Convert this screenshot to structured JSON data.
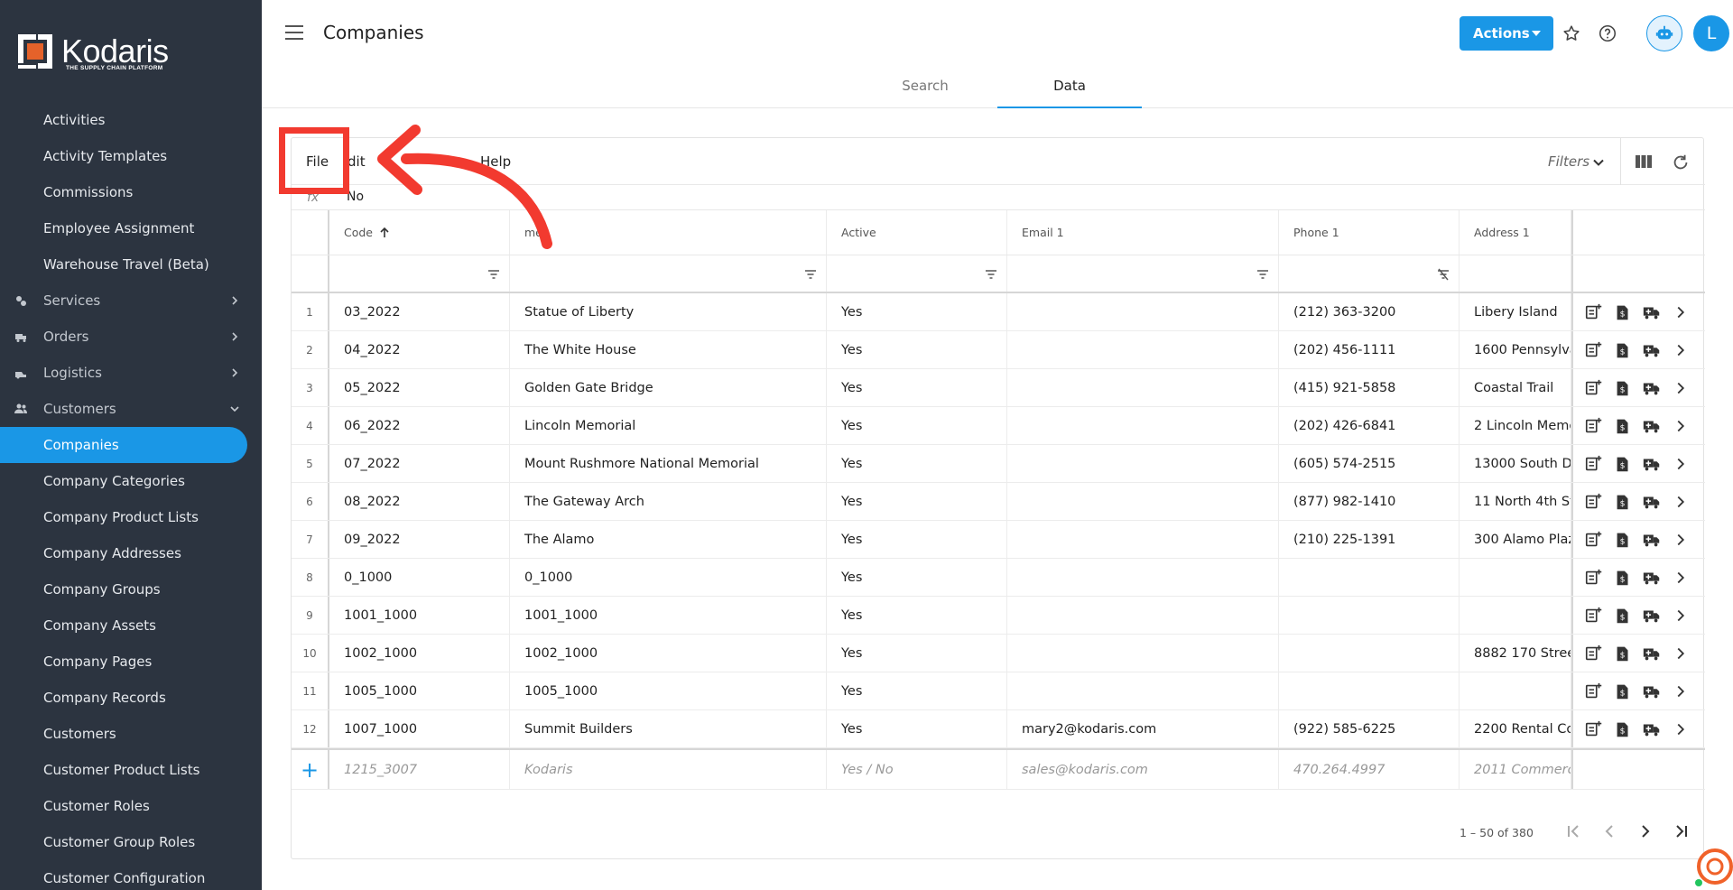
{
  "app": {
    "logo_text": "Kodaris",
    "logo_tagline": "THE SUPPLY CHAIN PLATFORM",
    "page_title": "Companies",
    "colors": {
      "sidebar_bg": "#2c3440",
      "accent": "#1a97e6",
      "annotation_red": "#f23a2f"
    }
  },
  "sidebar": {
    "items": [
      {
        "label": "Activities",
        "type": "sub"
      },
      {
        "label": "Activity Templates",
        "type": "sub"
      },
      {
        "label": "Commissions",
        "type": "sub"
      },
      {
        "label": "Employee Assignment",
        "type": "sub"
      },
      {
        "label": "Warehouse Travel (Beta)",
        "type": "sub"
      },
      {
        "label": "Services",
        "type": "group",
        "icon": "gears-icon",
        "chevron": "right"
      },
      {
        "label": "Orders",
        "type": "group",
        "icon": "truck-icon",
        "chevron": "right"
      },
      {
        "label": "Logistics",
        "type": "group",
        "icon": "shipping-icon",
        "chevron": "right"
      },
      {
        "label": "Customers",
        "type": "group",
        "icon": "people-icon",
        "chevron": "down"
      },
      {
        "label": "Companies",
        "type": "sub",
        "active": true
      },
      {
        "label": "Company Categories",
        "type": "sub"
      },
      {
        "label": "Company Product Lists",
        "type": "sub"
      },
      {
        "label": "Company Addresses",
        "type": "sub"
      },
      {
        "label": "Company Groups",
        "type": "sub"
      },
      {
        "label": "Company Assets",
        "type": "sub"
      },
      {
        "label": "Company Pages",
        "type": "sub"
      },
      {
        "label": "Company Records",
        "type": "sub"
      },
      {
        "label": "Customers",
        "type": "sub"
      },
      {
        "label": "Customer Product Lists",
        "type": "sub"
      },
      {
        "label": "Customer Roles",
        "type": "sub"
      },
      {
        "label": "Customer Group Roles",
        "type": "sub"
      },
      {
        "label": "Customer Configuration",
        "type": "sub"
      }
    ]
  },
  "header": {
    "actions_label": "Actions",
    "avatar_initial": "L",
    "tabs": [
      {
        "label": "Search"
      },
      {
        "label": "Data",
        "active": true
      }
    ]
  },
  "toolbar": {
    "menu": [
      "File",
      "dit",
      "Help"
    ],
    "filters_label": "Filters",
    "fx_label": "fx",
    "fx_value": "No"
  },
  "grid": {
    "columns": [
      "Code",
      "me",
      "Active",
      "Email 1",
      "Phone 1",
      "Address 1"
    ],
    "rows": [
      {
        "n": "1",
        "code": "03_2022",
        "name": "Statue of Liberty",
        "active": "Yes",
        "email": "",
        "phone": "(212) 363-3200",
        "address": "Libery Island"
      },
      {
        "n": "2",
        "code": "04_2022",
        "name": "The White House",
        "active": "Yes",
        "email": "",
        "phone": "(202) 456-1111",
        "address": "1600 Pennsylva"
      },
      {
        "n": "3",
        "code": "05_2022",
        "name": "Golden Gate Bridge",
        "active": "Yes",
        "email": "",
        "phone": "(415) 921-5858",
        "address": "Coastal Trail"
      },
      {
        "n": "4",
        "code": "06_2022",
        "name": "Lincoln Memorial",
        "active": "Yes",
        "email": "",
        "phone": "(202) 426-6841",
        "address": "2 Lincoln Memo"
      },
      {
        "n": "5",
        "code": "07_2022",
        "name": "Mount Rushmore National Memorial",
        "active": "Yes",
        "email": "",
        "phone": "(605) 574-2515",
        "address": "13000 South D"
      },
      {
        "n": "6",
        "code": "08_2022",
        "name": "The Gateway Arch",
        "active": "Yes",
        "email": "",
        "phone": "(877) 982-1410",
        "address": "11 North 4th St"
      },
      {
        "n": "7",
        "code": "09_2022",
        "name": "The Alamo",
        "active": "Yes",
        "email": "",
        "phone": "(210) 225-1391",
        "address": "300 Alamo Plaz"
      },
      {
        "n": "8",
        "code": "0_1000",
        "name": "0_1000",
        "active": "Yes",
        "email": "",
        "phone": "",
        "address": ""
      },
      {
        "n": "9",
        "code": "1001_1000",
        "name": "1001_1000",
        "active": "Yes",
        "email": "",
        "phone": "",
        "address": ""
      },
      {
        "n": "10",
        "code": "1002_1000",
        "name": "1002_1000",
        "active": "Yes",
        "email": "",
        "phone": "",
        "address": "8882 170 Stree"
      },
      {
        "n": "11",
        "code": "1005_1000",
        "name": "1005_1000",
        "active": "Yes",
        "email": "",
        "phone": "",
        "address": ""
      },
      {
        "n": "12",
        "code": "1007_1000",
        "name": "Summit Builders",
        "active": "Yes",
        "email": "mary2@kodaris.com",
        "phone": "(922) 585-6225",
        "address": "2200 Rental Co"
      }
    ],
    "new_row": {
      "plus": "+",
      "code": "1215_3007",
      "name": "Kodaris",
      "active": "Yes / No",
      "email": "sales@kodaris.com",
      "phone": "470.264.4997",
      "address": "2011 Commerc"
    },
    "pager": "1 – 50 of 380"
  }
}
